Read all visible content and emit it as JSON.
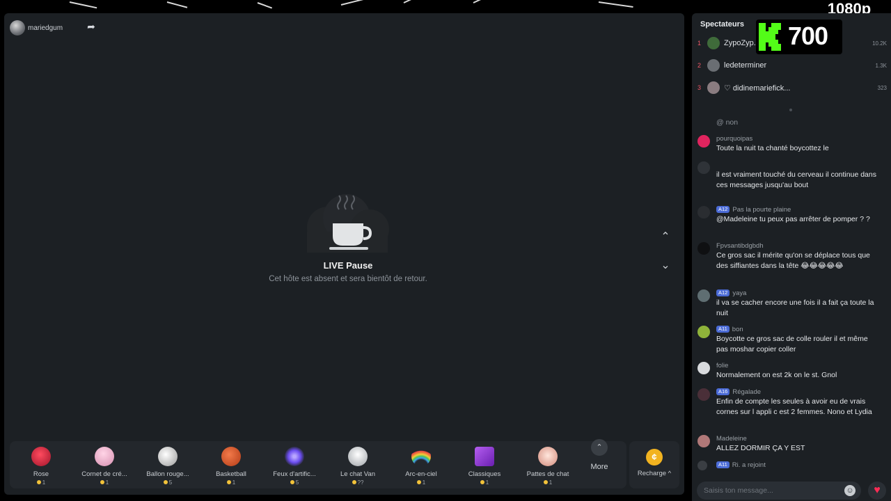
{
  "stream": {
    "resolution": "1080p",
    "host_name": "mariedgum",
    "pause_title": "LIVE Pause",
    "pause_subtitle": "Cet hôte est absent et sera bientôt de retour."
  },
  "kick_badge": {
    "count": "700"
  },
  "gifts": [
    {
      "name": "Rose",
      "price": "1",
      "icon": "rose-icon",
      "color": "#d0213b"
    },
    {
      "name": "Cornet de cré...",
      "price": "1",
      "icon": "ice-cream-icon",
      "color": "#f4b6cf"
    },
    {
      "name": "Ballon rouge...",
      "price": "5",
      "icon": "soccer-ball-icon",
      "color": "#e9e9e9"
    },
    {
      "name": "Basketball",
      "price": "1",
      "icon": "basketball-icon",
      "color": "#e2572c"
    },
    {
      "name": "Feux d'artific...",
      "price": "5",
      "icon": "fireworks-icon",
      "color": "#7a5cff"
    },
    {
      "name": "Le chat Van",
      "price": "??",
      "icon": "cat-icon",
      "color": "#e8e8e8"
    },
    {
      "name": "Arc-en-ciel",
      "price": "1",
      "icon": "rainbow-icon",
      "color": "#f0a13a"
    },
    {
      "name": "Classiques",
      "price": "1",
      "icon": "ticket-icon",
      "color": "#8a3fd1"
    },
    {
      "name": "Pattes de chat",
      "price": "1",
      "icon": "paw-icon",
      "color": "#f2d0c4"
    }
  ],
  "more": {
    "label": "More",
    "icon": "chevron-up-icon"
  },
  "recharge": {
    "label": "Recharge ^",
    "icon": "coin-icon"
  },
  "viewers": {
    "title": "Spectateurs",
    "top": [
      {
        "rank": "1",
        "name": "ZypoZyp...",
        "score": "10.2K"
      },
      {
        "rank": "2",
        "name": "ledeterminer",
        "score": "1.3K"
      },
      {
        "rank": "3",
        "name": "♡ didinemariefick...",
        "score": "323"
      }
    ]
  },
  "chat": [
    {
      "user": "",
      "text": "@ non"
    },
    {
      "user": "pourquoipas",
      "text": "Toute la nuit ta chanté boycottez le"
    },
    {
      "user": "",
      "text": "il est vraiment touché du cerveau il continue dans ces messages jusqu'au bout"
    },
    {
      "user": "Pas la pourte plaine",
      "level": "A12",
      "text": "@Madeleine tu peux pas arrêter de pomper ? ?"
    },
    {
      "user": "Fpvsantibdgbdh",
      "text": "Ce gros sac il mérite qu'on se déplace tous que des siffiantes dans la tête 😂😂😂😂😂"
    },
    {
      "user": "yaya",
      "level": "A12",
      "text": "il va se cacher encore une fois il a fait ça toute la nuit"
    },
    {
      "user": "bon",
      "level": "A11",
      "text": "Boycotte ce gros sac de colle rouler il et même pas moshar copier coller"
    },
    {
      "user": "folie",
      "text": "Normalement on est 2k on le st. Gnol"
    },
    {
      "user": "Régalade",
      "level": "A16",
      "text": "Enfin de compte les seules à avoir eu de vrais cornes sur l appli c est 2 femmes. Nono et Lydia"
    },
    {
      "user": "Madeleine",
      "text": "ALLEZ DORMIR ÇA Y EST"
    },
    {
      "user": "",
      "level": "A11",
      "text": "Ri. a rejoint"
    }
  ],
  "input": {
    "placeholder": "Saisis ton message..."
  }
}
